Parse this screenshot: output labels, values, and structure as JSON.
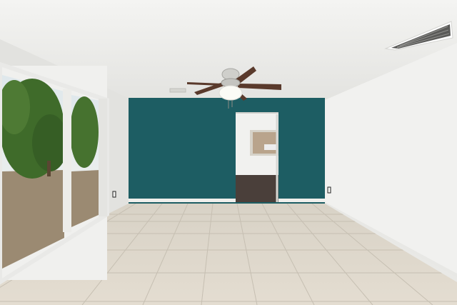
{
  "scene": {
    "subject": "empty-room-interior",
    "colors": {
      "ceiling": "#eeeeec",
      "left_wall": "#e6e6e3",
      "right_wall": "#f2f2f0",
      "accent_wall": "#1d5d63",
      "floor_tile": "#dcd6cb",
      "grout": "#c9c2b5",
      "doorway": "#4a3f3a",
      "tree": "#3f6b2a",
      "ground": "#9b8a72"
    },
    "fixtures": [
      "ceiling-fan",
      "ceiling-vent",
      "sliding-glass-door",
      "doorway",
      "electrical-outlet"
    ]
  }
}
